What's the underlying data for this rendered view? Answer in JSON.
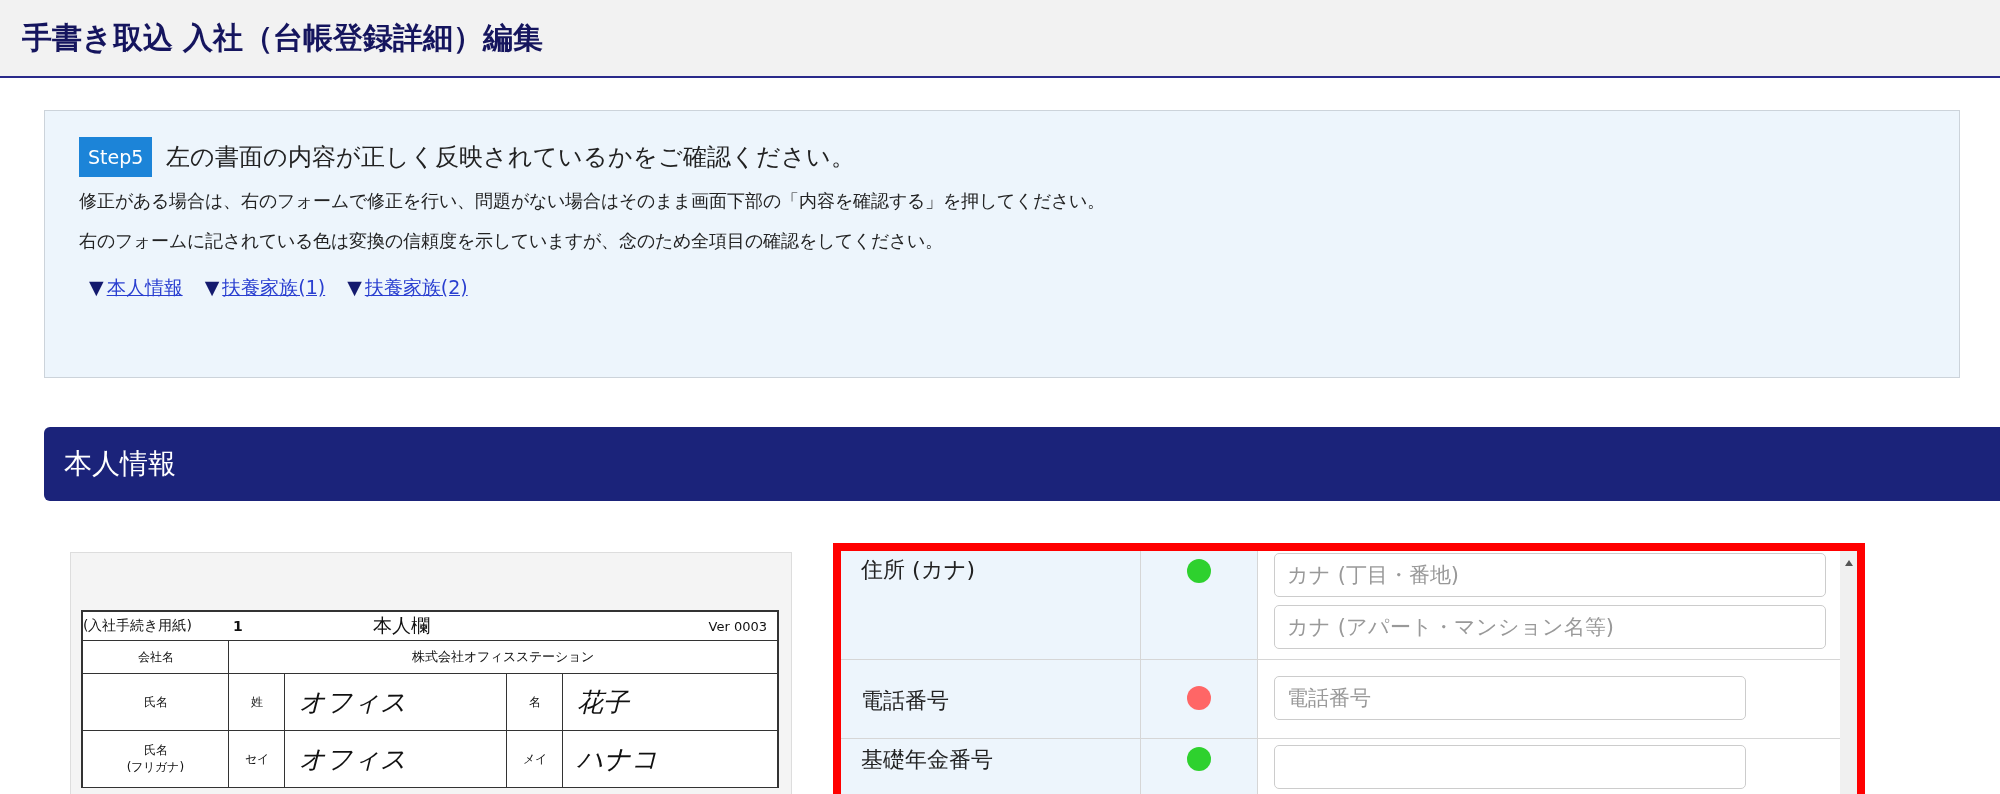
{
  "page_title": "手書き取込 入社（台帳登録詳細）編集",
  "notice": {
    "step_badge": "Step5",
    "heading": "左の書面の内容が正しく反映されているかをご確認ください。",
    "lines": [
      "修正がある場合は、右のフォームで修正を行い、問題がない場合はそのまま画面下部の「内容を確認する」を押してください。",
      "右のフォームに記されている色は変換の信頼度を示していますが、念のため全項目の確認をしてください。"
    ],
    "links": [
      {
        "marker": "▼",
        "label": "本人情報"
      },
      {
        "marker": "▼",
        "label": "扶養家族(1)"
      },
      {
        "marker": "▼",
        "label": "扶養家族(2)"
      }
    ]
  },
  "section_title": "本人情報",
  "document": {
    "form_name": "(入社手続き用紙)",
    "page_no": "1",
    "sheet_title": "本人欄",
    "version": "Ver 0003",
    "company_label": "会社名",
    "company": "株式会社オフィスステーション",
    "name_rows": [
      {
        "label": "氏名",
        "first_label": "姓",
        "first": "オフィス",
        "second_label": "名",
        "second": "花子"
      },
      {
        "label": "氏名\n(フリガナ)",
        "first_label": "セイ",
        "first": "オフィス",
        "second_label": "メイ",
        "second": "ハナコ"
      }
    ]
  },
  "form_rows": [
    {
      "label": "住所 (カナ)",
      "color": "#2ed12e",
      "inputs": [
        {
          "kind": "wide",
          "placeholder": "カナ (丁目・番地)"
        },
        {
          "kind": "wide",
          "placeholder": "カナ (アパート・マンション名等)"
        }
      ]
    },
    {
      "label": "電話番号",
      "color": "#ff6666",
      "inputs": [
        {
          "kind": "short",
          "placeholder": "電話番号"
        }
      ]
    },
    {
      "label": "基礎年金番号",
      "color": "#2ed12e",
      "inputs": [
        {
          "kind": "short"
        }
      ]
    }
  ]
}
